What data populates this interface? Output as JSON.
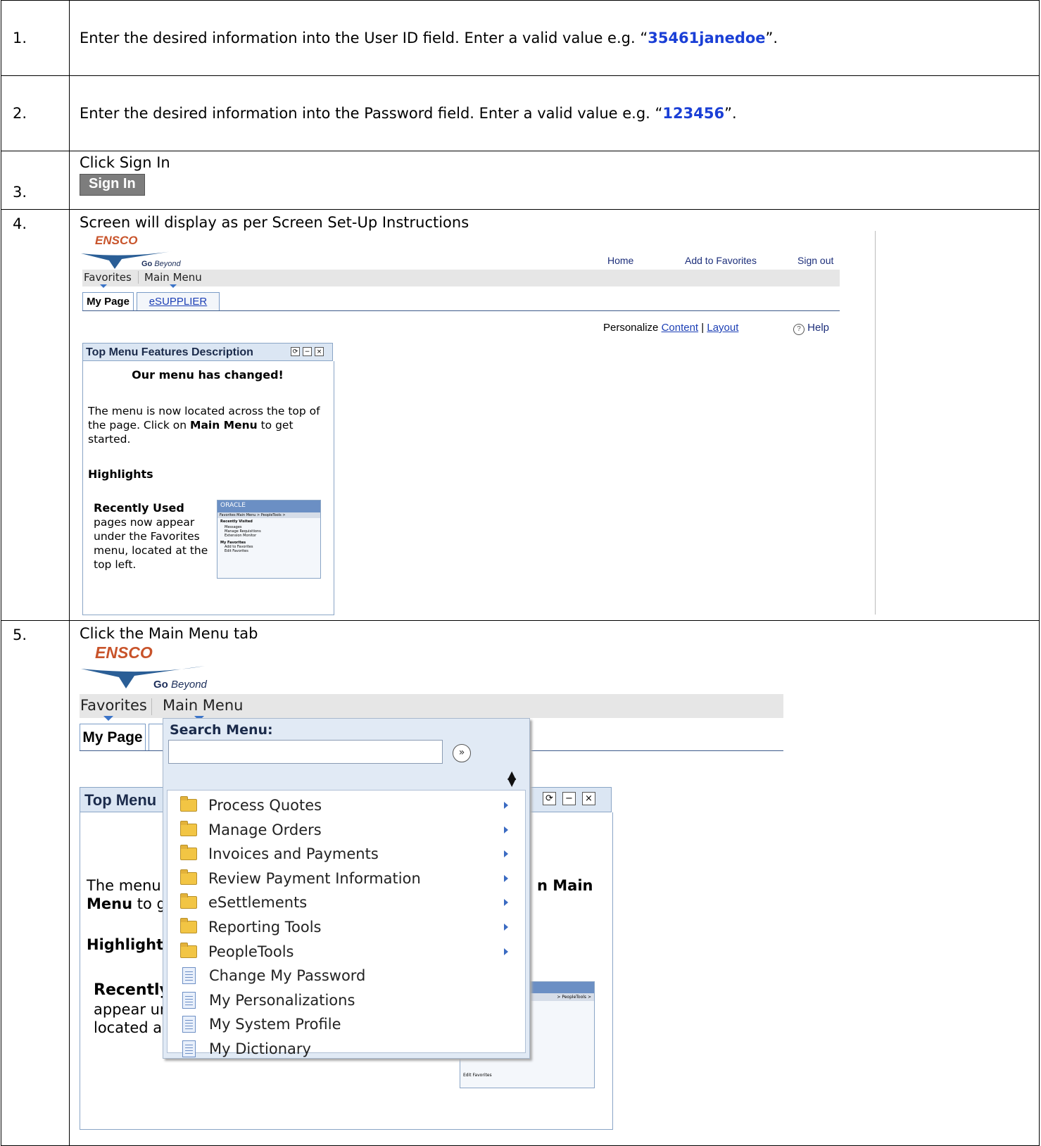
{
  "steps": [
    {
      "num": "1.",
      "text_before": "Enter the desired information into the User ID field. Enter a valid value e.g. “",
      "value": "35461janedoe",
      "text_after": "”."
    },
    {
      "num": "2.",
      "text_before": "Enter the desired information into the Password field. Enter a valid value e.g. “",
      "value": "123456",
      "text_after": "”."
    },
    {
      "num": "3.",
      "text": "Click Sign In",
      "button_label": "Sign In"
    },
    {
      "num": "4.",
      "text": "Screen will display as per Screen Set-Up Instructions"
    },
    {
      "num": "5.",
      "text": "Click the Main Menu tab"
    }
  ],
  "shot1": {
    "logo": "ENSCO",
    "tagline_go": "Go",
    "tagline_beyond": "Beyond",
    "header_links": [
      "Home",
      "Add to Favorites",
      "Sign out"
    ],
    "menubar": [
      "Favorites",
      "Main Menu"
    ],
    "tabs": [
      "My Page",
      "eSUPPLIER"
    ],
    "personalize": "Personalize",
    "content_link": "Content",
    "sep": "|",
    "layout_link": "Layout",
    "help": "Help",
    "pagelet_title": "Top Menu Features Description",
    "pagelet_heading": "Our menu has changed!",
    "para_1": "The menu is now located across the top of the page. Click on ",
    "para_bold": "Main Menu",
    "para_2": " to get started.",
    "highlights": "Highlights",
    "recently_used": "Recently Used",
    "recent_text": "pages now appear under the Favorites menu, located at the top left.",
    "mini": {
      "brand": "ORACLE",
      "bar": "Favorites     Main Menu  >  PeopleTools  >",
      "h1": "Recently Visited",
      "i1": "Messages",
      "i2": "Manage Requisitions",
      "i3": "Extension Monitor",
      "h2": "My Favorites",
      "i4": "Add to Favorites",
      "i5": "Edit Favorites"
    }
  },
  "shot2": {
    "logo": "ENSCO",
    "tagline_go": "Go",
    "tagline_beyond": "Beyond",
    "menubar": [
      "Favorites",
      "Main Menu"
    ],
    "tab_mypage": "My Page",
    "search_label": "Search Menu:",
    "search_value": "",
    "pagelet_title_partial": "Top Menu",
    "text_menu": "The menu",
    "text_main": "n Main",
    "text_menu_to": "Menu",
    "text_to_g": " to g",
    "highlights_partial": "Highlight",
    "recently_partial": "Recently",
    "appear_partial": "appear ur",
    "located_partial": "located a",
    "mini_bar_partial": "> PeopleTools >",
    "mini_edit": "Edit Favorites",
    "menu_items": [
      {
        "label": "Process Quotes",
        "icon": "folder-icon",
        "arrow": true
      },
      {
        "label": "Manage Orders",
        "icon": "folder-icon",
        "arrow": true
      },
      {
        "label": "Invoices and Payments",
        "icon": "folder-icon",
        "arrow": true
      },
      {
        "label": "Review Payment Information",
        "icon": "folder-icon",
        "arrow": true
      },
      {
        "label": "eSettlements",
        "icon": "folder-icon",
        "arrow": true
      },
      {
        "label": "Reporting Tools",
        "icon": "folder-icon",
        "arrow": true
      },
      {
        "label": "PeopleTools",
        "icon": "folder-icon",
        "arrow": true
      },
      {
        "label": "Change My Password",
        "icon": "page-icon",
        "arrow": false
      },
      {
        "label": "My Personalizations",
        "icon": "page-icon",
        "arrow": false
      },
      {
        "label": "My System Profile",
        "icon": "page-icon",
        "arrow": false
      },
      {
        "label": "My Dictionary",
        "icon": "page-icon",
        "arrow": false
      }
    ]
  },
  "colors": {
    "value_blue": "#1a3fd6",
    "ensco_orange": "#c8532a",
    "link_blue": "#1c3fb5"
  }
}
